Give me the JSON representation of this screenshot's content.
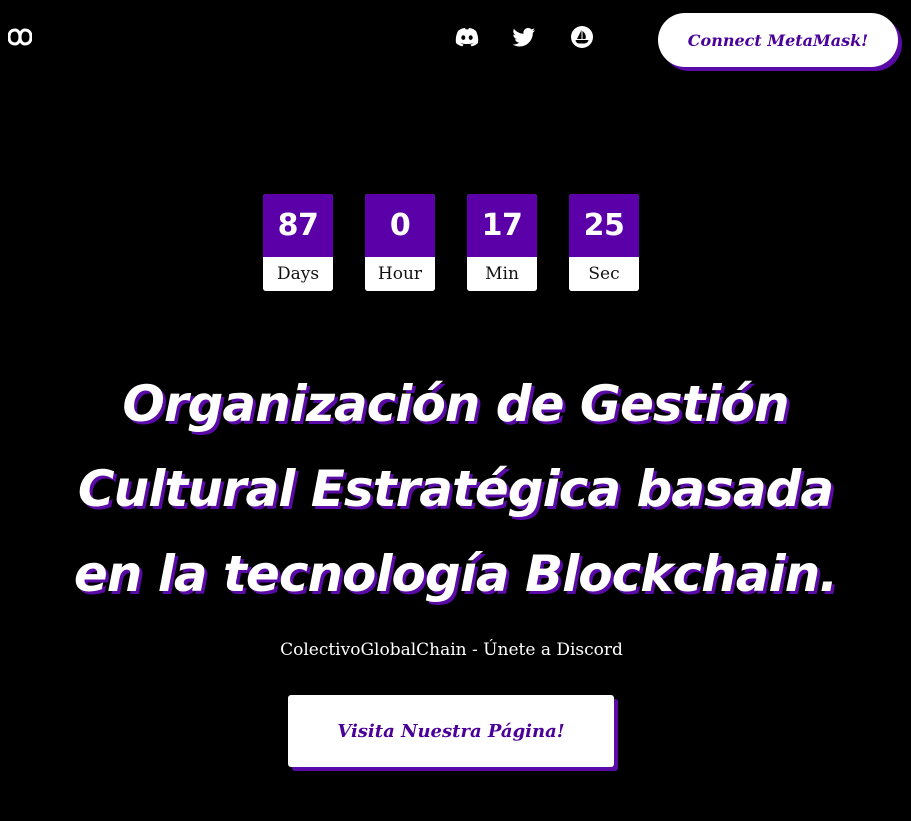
{
  "nav": {
    "logo_icon": "infinity-logo-icon",
    "social": [
      {
        "name": "discord-icon"
      },
      {
        "name": "twitter-icon"
      },
      {
        "name": "opensea-icon"
      }
    ],
    "connect_label": "Connect MetaMask!"
  },
  "countdown": {
    "days": {
      "value": "87",
      "label": "Days"
    },
    "hours": {
      "value": "0",
      "label": "Hour"
    },
    "minutes": {
      "value": "17",
      "label": "Min"
    },
    "seconds": {
      "value": "25",
      "label": "Sec"
    }
  },
  "hero": {
    "line1": "Organización de Gestión",
    "line2": "Cultural Estratégica basada",
    "line3": "en la tecnología Blockchain.",
    "subtitle": "ColectivoGlobalChain - Únete a Discord",
    "cta_label": "Visita Nuestra Página!"
  },
  "colors": {
    "background": "#000000",
    "accent": "#5b00a8",
    "button_text": "#4a0099",
    "text": "#ffffff"
  }
}
